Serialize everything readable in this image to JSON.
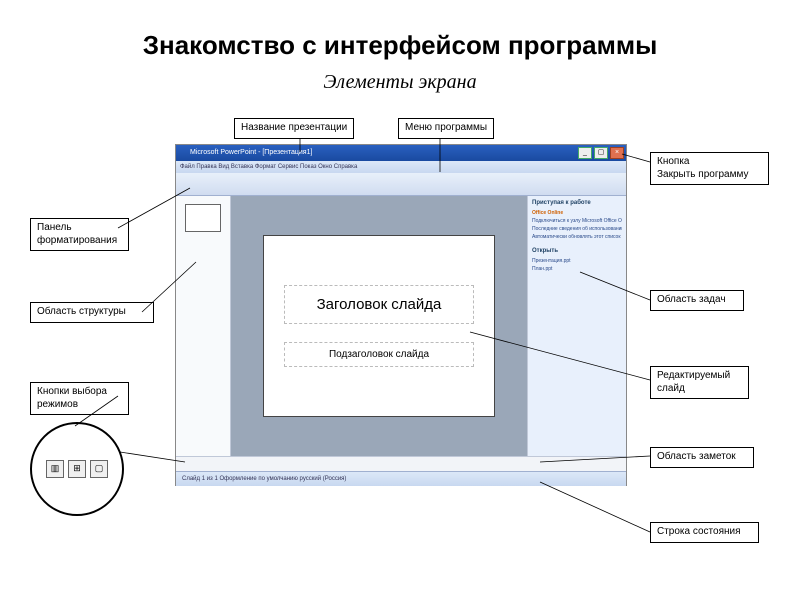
{
  "page_title": "Знакомство с интерфейсом программы",
  "subtitle": "Элементы экрана",
  "callouts": {
    "presentation_name": "Название презентации",
    "program_menu": "Меню программы",
    "close_button": "Кнопка\nЗакрыть программу",
    "task_pane": "Область задач",
    "editable_slide": "Редактируемый слайд",
    "notes_area": "Область заметок",
    "status_bar": "Строка состояния",
    "format_panel": "Панель форматирования",
    "structure_area": "Область  структуры",
    "view_buttons": "Кнопки выбора режимов"
  },
  "powerpoint": {
    "titlebar": "Microsoft PowerPoint - [Презентация1]",
    "menubar": "Файл  Правка  Вид  Вставка  Формат  Сервис  Показ  Окно  Справка",
    "slide": {
      "title_placeholder": "Заголовок слайда",
      "subtitle_placeholder": "Подзаголовок слайда"
    },
    "taskpane": {
      "heading": "Приступая к работе",
      "brand": "Office Online",
      "items": [
        "Подключиться к узлу Microsoft Office Online",
        "Последние сведения об использовании",
        "Автоматически обновлять этот список"
      ],
      "open_label": "Открыть",
      "recent": [
        "Презентация.ppt",
        "План.ppt"
      ]
    },
    "statusbar": "Слайд 1 из 1    Оформление по умолчанию    русский (Россия)"
  }
}
